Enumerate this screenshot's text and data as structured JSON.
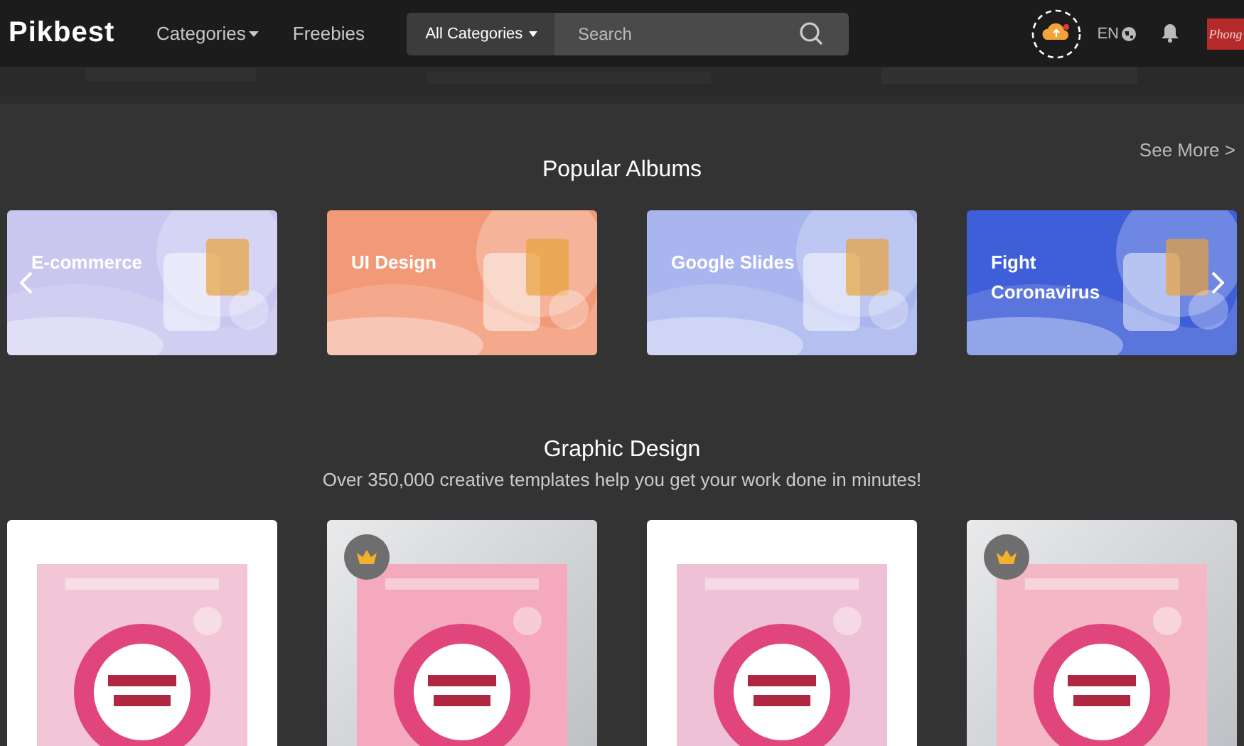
{
  "header": {
    "logo": "Pikbest",
    "nav": [
      {
        "label": "Categories",
        "dropdown": true
      },
      {
        "label": "Freebies",
        "dropdown": false
      }
    ],
    "search": {
      "category": "All Categories",
      "placeholder": "Search"
    },
    "language": "EN",
    "avatar": "Phong"
  },
  "albums": {
    "title": "Popular Albums",
    "see_more": "See More >",
    "items": [
      {
        "label": "E-commerce",
        "color": "#c9c6f0"
      },
      {
        "label": "UI Design",
        "color": "#f29a78"
      },
      {
        "label": "Google Slides",
        "color": "#a9b5ee"
      },
      {
        "label": "Fight Coronavirus",
        "color": "#3e5fd8"
      }
    ]
  },
  "graphic": {
    "title": "Graphic Design",
    "subtitle": "Over 350,000 creative templates help you get your work done in minutes!",
    "items": [
      {
        "premium": false,
        "color": "#f2c6d6"
      },
      {
        "premium": true,
        "color": "#f4a9bf"
      },
      {
        "premium": false,
        "color": "#eec1d6"
      },
      {
        "premium": true,
        "color": "#f3b8c4"
      }
    ]
  }
}
